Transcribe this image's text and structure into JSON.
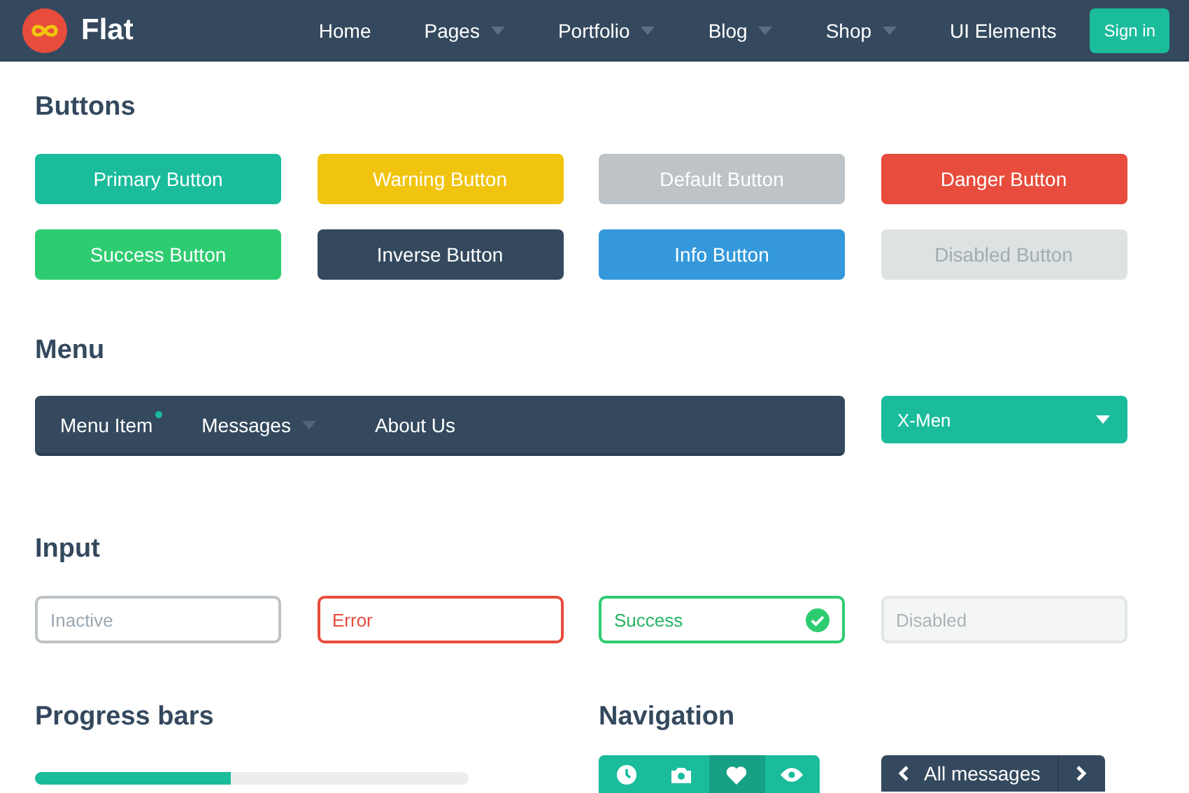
{
  "navbar": {
    "brand": "Flat",
    "items": [
      {
        "label": "Home",
        "dropdown": false
      },
      {
        "label": "Pages",
        "dropdown": true
      },
      {
        "label": "Portfolio",
        "dropdown": true
      },
      {
        "label": "Blog",
        "dropdown": true
      },
      {
        "label": "Shop",
        "dropdown": true
      },
      {
        "label": "UI Elements",
        "dropdown": false
      }
    ],
    "sign_in": "Sign in"
  },
  "buttons": {
    "title": "Buttons",
    "items": [
      {
        "label": "Primary Button",
        "kind": "primary"
      },
      {
        "label": "Warning Button",
        "kind": "warning"
      },
      {
        "label": "Default Button",
        "kind": "default"
      },
      {
        "label": "Danger Button",
        "kind": "danger"
      },
      {
        "label": "Success Button",
        "kind": "success"
      },
      {
        "label": "Inverse Button",
        "kind": "inverse"
      },
      {
        "label": "Info Button",
        "kind": "info"
      },
      {
        "label": "Disabled Button",
        "kind": "disabled"
      }
    ]
  },
  "menu": {
    "title": "Menu",
    "items": [
      {
        "label": "Menu Item",
        "dot": true,
        "dropdown": false
      },
      {
        "label": "Messages",
        "dot": false,
        "dropdown": true
      },
      {
        "label": "About Us",
        "dot": false,
        "dropdown": false
      }
    ],
    "select": {
      "value": "X-Men"
    }
  },
  "input": {
    "title": "Input",
    "fields": [
      {
        "placeholder": "Inactive",
        "kind": "default"
      },
      {
        "placeholder": "Error",
        "kind": "error"
      },
      {
        "placeholder": "Success",
        "kind": "success"
      },
      {
        "placeholder": "Disabled",
        "kind": "disabled"
      }
    ]
  },
  "progress": {
    "title": "Progress bars",
    "level": 0.45
  },
  "navigation": {
    "title": "Navigation",
    "icons": [
      {
        "selected": false
      },
      {
        "selected": false
      },
      {
        "selected": true
      },
      {
        "selected": false
      }
    ],
    "pager": {
      "label": "All messages"
    }
  }
}
